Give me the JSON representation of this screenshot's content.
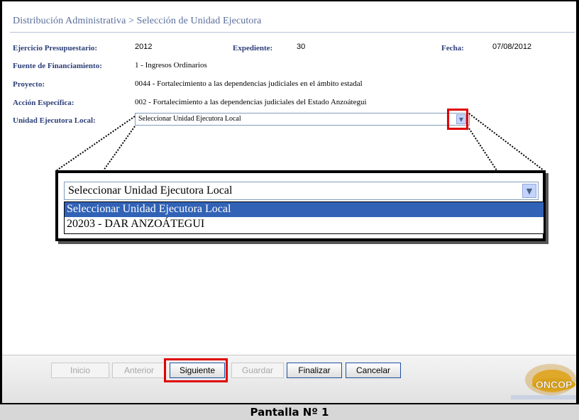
{
  "header": {
    "title": "Distribución Administrativa > Selección de Unidad Ejecutora"
  },
  "form": {
    "ejercicio_label": "Ejercicio Presupuestario:",
    "ejercicio_value": "2012",
    "expediente_label": "Expediente:",
    "expediente_value": "30",
    "fecha_label": "Fecha:",
    "fecha_value": "07/08/2012",
    "fuente_label": "Fuente de Financiamiento:",
    "fuente_value": "1 - Ingresos Ordinarios",
    "proyecto_label": "Proyecto:",
    "proyecto_value": "0044 - Fortalecimiento a las dependencias judiciales en el ámbito estadal",
    "accion_label": "Acción Específica:",
    "accion_value": "002 - Fortalecimiento a las dependencias judiciales del Estado Anzoátegui",
    "unidad_label": "Unidad Ejecutora Local:",
    "unidad_selected": "Seleccionar Unidad Ejecutora Local"
  },
  "zoom": {
    "selected": "Seleccionar Unidad Ejecutora Local",
    "options": [
      "Seleccionar Unidad Ejecutora Local",
      "20203 - DAR ANZOÁTEGUI"
    ]
  },
  "toolbar": {
    "inicio": "Inicio",
    "anterior": "Anterior",
    "siguiente": "Siguiente",
    "guardar": "Guardar",
    "finalizar": "Finalizar",
    "cancelar": "Cancelar"
  },
  "logo": {
    "text": "ONCOP"
  },
  "caption": "Pantalla Nº 1",
  "colors": {
    "label": "#2c3f78",
    "title": "#5a6e9a",
    "highlight": "#e00000",
    "selected_option": "#3162b6"
  }
}
